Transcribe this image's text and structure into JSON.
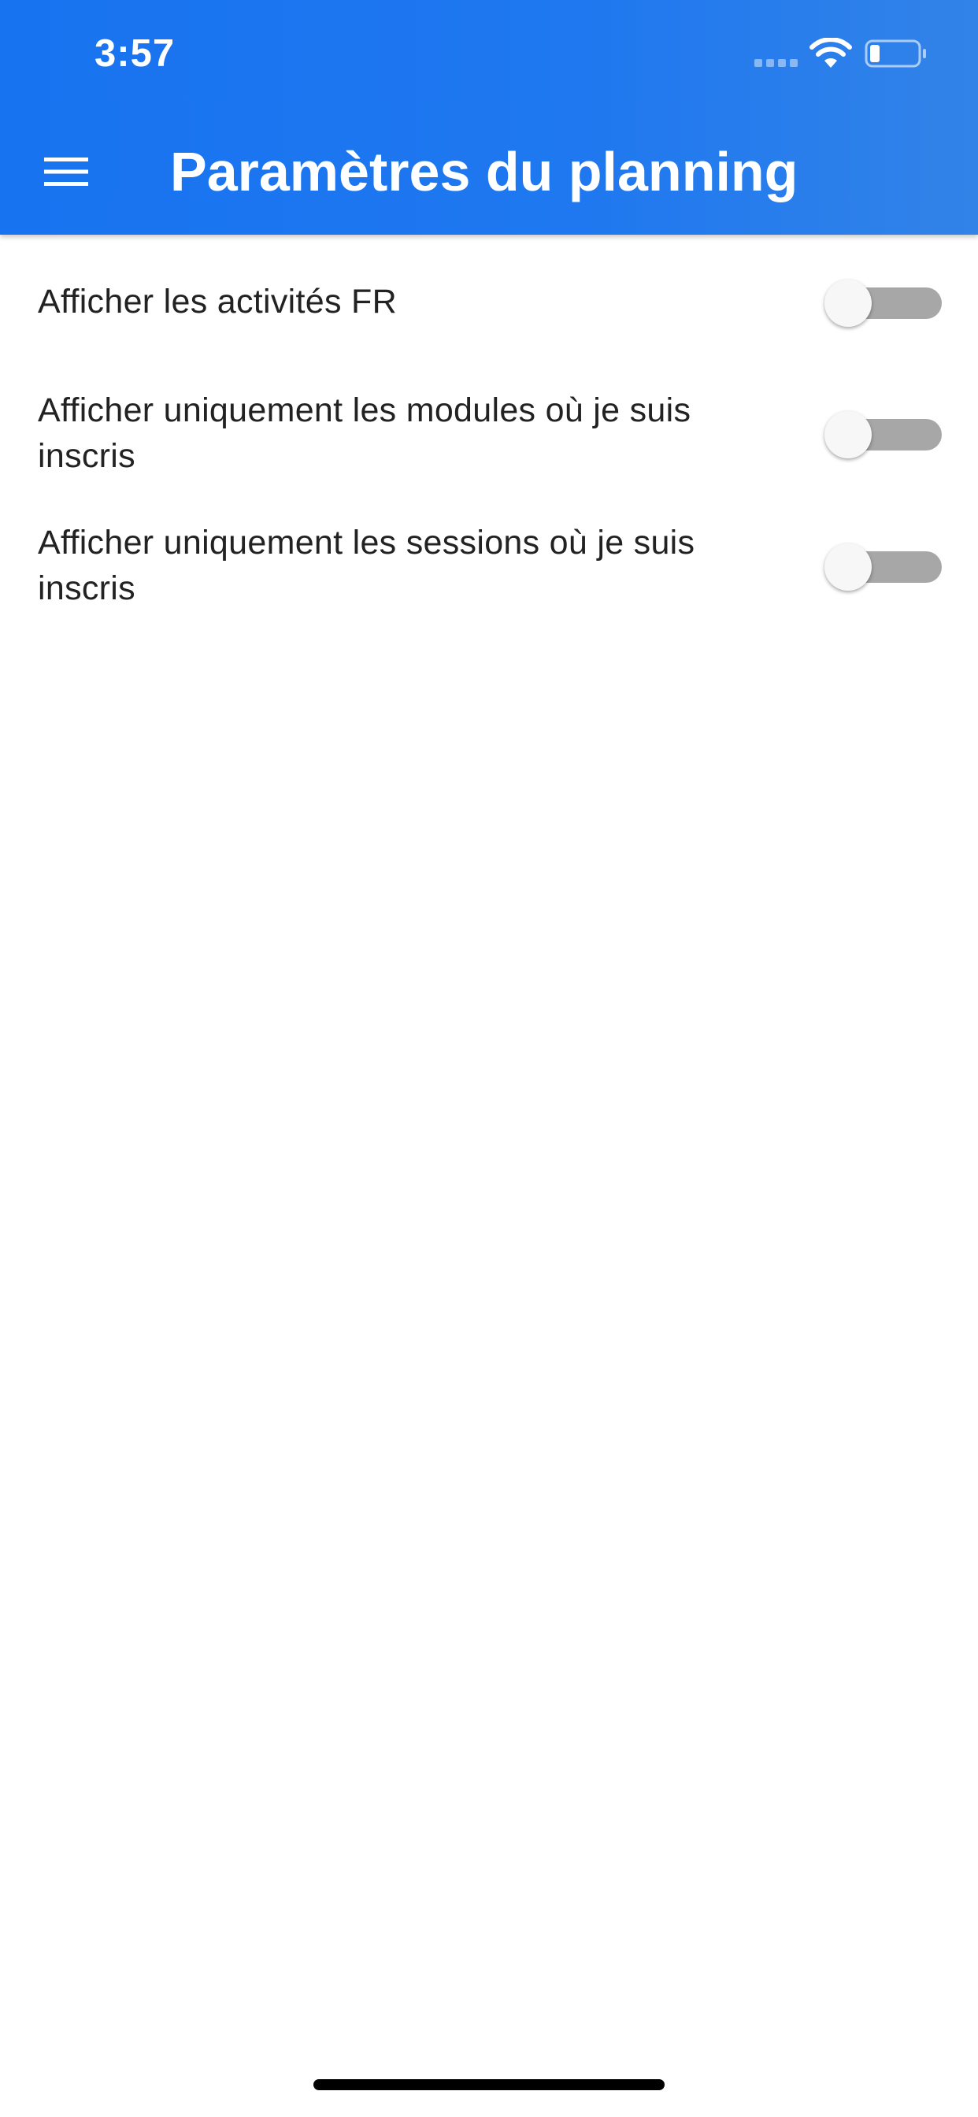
{
  "status_bar": {
    "time": "3:57",
    "signal_icon": "signal-dots-icon",
    "wifi_icon": "wifi-icon",
    "battery_icon": "battery-low-icon"
  },
  "header": {
    "menu_icon": "hamburger-menu-icon",
    "title": "Paramètres du planning",
    "background_color": "#1f78ef"
  },
  "settings": [
    {
      "label": "Afficher les activités FR",
      "enabled": false
    },
    {
      "label": "Afficher uniquement les modules où je suis inscris",
      "enabled": false
    },
    {
      "label": "Afficher uniquement les sessions où je suis inscris",
      "enabled": false
    }
  ]
}
